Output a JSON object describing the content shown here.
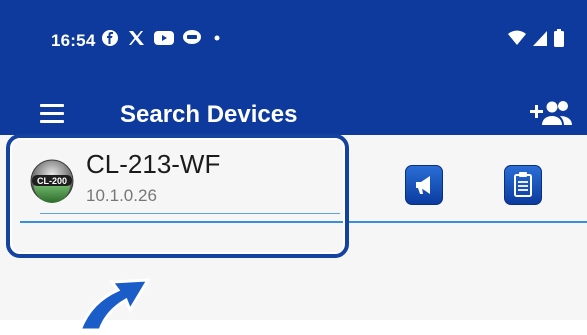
{
  "status_bar": {
    "time": "16:54",
    "icons": [
      "facebook-icon",
      "x-icon",
      "youtube-icon",
      "line-icon",
      "dot-icon"
    ],
    "right_icons": [
      "wifi-icon",
      "signal-icon",
      "battery-icon"
    ]
  },
  "app_bar": {
    "title": "Search Devices",
    "menu_icon": "menu-icon",
    "action_icon": "add-people-icon"
  },
  "device": {
    "logo_text": "CL-200",
    "name": "CL-213-WF",
    "ip": "10.1.0.26",
    "actions": [
      "announce-icon",
      "clipboard-icon"
    ]
  },
  "colors": {
    "header": "#0d3a9c",
    "highlight": "#13439f",
    "divider": "#3b8fd8",
    "arrow": "#1a5cc8"
  }
}
